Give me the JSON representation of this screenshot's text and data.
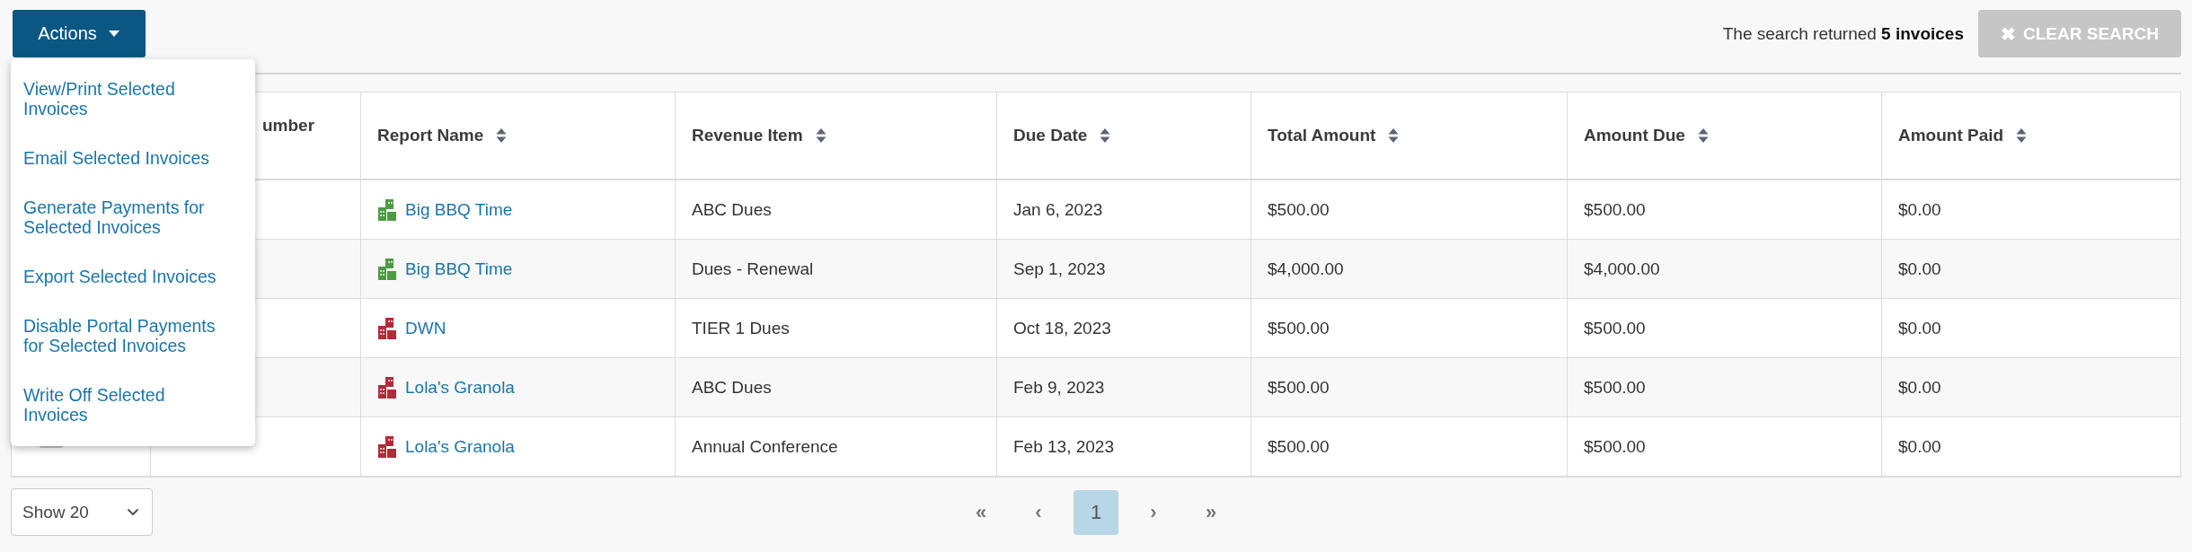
{
  "actions_button": {
    "label": "Actions",
    "expanded": true
  },
  "actions_menu": [
    {
      "label": "View/Print Selected Invoices"
    },
    {
      "label": "Email Selected Invoices"
    },
    {
      "label": "Generate Payments for Selected Invoices"
    },
    {
      "label": "Export Selected Invoices"
    },
    {
      "label": "Disable Portal Payments for Selected Invoices"
    },
    {
      "label": "Write Off Selected Invoices"
    }
  ],
  "search_summary": "The search returned **5 invoices**",
  "clear_search_button": {
    "icon": "✖",
    "label": "CLEAR SEARCH",
    "disabled": true
  },
  "table": {
    "columns": [
      {
        "label": "umber",
        "sortable": false
      },
      {
        "label": "Report Name",
        "sortable": true
      },
      {
        "label": "Revenue Item",
        "sortable": true
      },
      {
        "label": "Due Date",
        "sortable": true
      },
      {
        "label": "Total Amount",
        "sortable": true
      },
      {
        "label": "Amount Due",
        "sortable": true
      },
      {
        "label": "Amount Paid",
        "sortable": true
      }
    ],
    "rows": [
      {
        "report_name": "Big BBQ Time",
        "color": "#4e9a45",
        "revenue_item": "ABC Dues",
        "due_date": "Jan 6, 2023",
        "total_amount": "$500.00",
        "amount_due": "$500.00",
        "amount_paid": "$0.00"
      },
      {
        "report_name": "Big BBQ Time",
        "color": "#4e9a45",
        "revenue_item": "Dues - Renewal",
        "due_date": "Sep 1, 2023",
        "total_amount": "$4,000.00",
        "amount_due": "$4,000.00",
        "amount_paid": "$0.00"
      },
      {
        "report_name": "DWN",
        "color": "#b22a3a",
        "revenue_item": "TIER 1 Dues",
        "due_date": "Oct 18, 2023",
        "total_amount": "$500.00",
        "amount_due": "$500.00",
        "amount_paid": "$0.00"
      },
      {
        "report_name": "Lola's Granola",
        "color": "#b22a3a",
        "revenue_item": "ABC Dues",
        "due_date": "Feb 9, 2023",
        "total_amount": "$500.00",
        "amount_due": "$500.00",
        "amount_paid": "$0.00"
      },
      {
        "report_name": "Lola's Granola",
        "color": "#b22a3a",
        "revenue_item": "Annual Conference",
        "due_date": "Feb 13, 2023",
        "total_amount": "$500.00",
        "amount_due": "$500.00",
        "amount_paid": "$0.00",
        "checked": false
      }
    ]
  },
  "page_size": {
    "value": "Show 20"
  },
  "pagination": [
    {
      "label": "«",
      "selected": false
    },
    {
      "label": "‹",
      "selected": false
    },
    {
      "label": "1",
      "selected": true
    },
    {
      "label": "›",
      "selected": false
    },
    {
      "label": "»",
      "selected": false
    }
  ]
}
